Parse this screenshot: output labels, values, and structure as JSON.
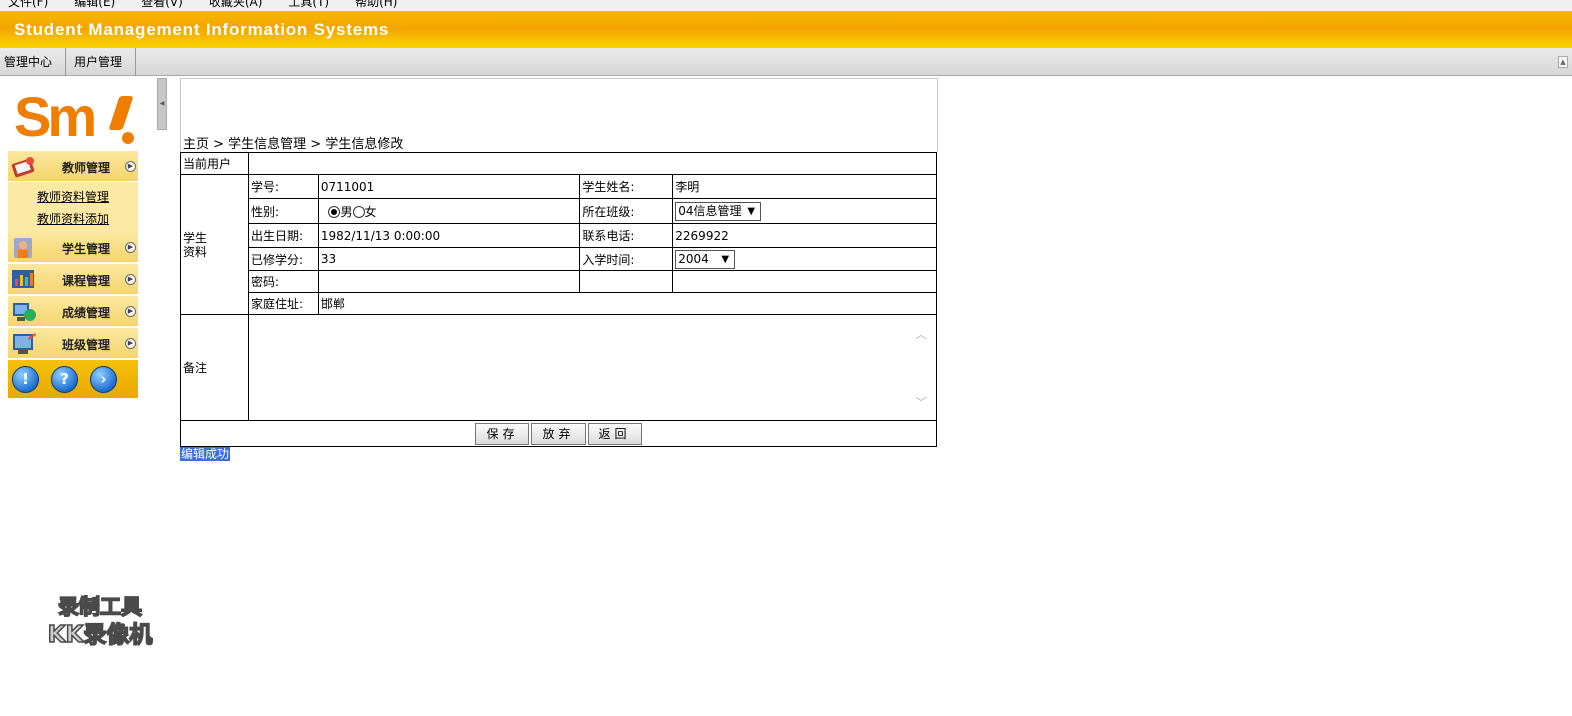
{
  "browser_menu": [
    "文件(F)",
    "编辑(E)",
    "查看(V)",
    "收藏夹(A)",
    "工具(T)",
    "帮助(H)"
  ],
  "banner": {
    "title": "Student Management Information Systems"
  },
  "tabs": [
    {
      "label": "管理中心"
    },
    {
      "label": "用户管理"
    }
  ],
  "sidebar": {
    "logo_text": "Sm",
    "menu": [
      {
        "label": "教师管理",
        "icon": "teacher-icon"
      },
      {
        "label": "学生管理",
        "icon": "student-icon"
      },
      {
        "label": "课程管理",
        "icon": "course-icon"
      },
      {
        "label": "成绩管理",
        "icon": "grade-icon"
      },
      {
        "label": "班级管理",
        "icon": "class-icon"
      }
    ],
    "submenu": [
      {
        "label": "教师资料管理"
      },
      {
        "label": "教师资料添加"
      }
    ],
    "bottom_icons": [
      {
        "glyph": "!",
        "icon": "info-icon"
      },
      {
        "glyph": "?",
        "icon": "help-icon"
      },
      {
        "glyph": "›",
        "icon": "next-icon"
      }
    ]
  },
  "breadcrumb": "主页 > 学生信息管理 > 学生信息修改",
  "form": {
    "current_user_label": "当前用户",
    "current_user_value": "",
    "student_section_label": "学生资料",
    "student_id_label": "学号:",
    "student_id_value": "0711001",
    "student_name_label": "学生姓名:",
    "student_name_value": "李明",
    "gender_label": "性别:",
    "gender_male": "男",
    "gender_female": "女",
    "gender_selected": "男",
    "class_label": "所在班级:",
    "class_value": "04信息管理",
    "birth_label": "出生日期:",
    "birth_value": "1982/11/13 0:00:00",
    "phone_label": "联系电话:",
    "phone_value": "2269922",
    "credits_label": "已修学分:",
    "credits_value": "33",
    "enroll_label": "入学时间:",
    "enroll_value": "2004",
    "password_label": "密码:",
    "password_value": "",
    "address_label": "家庭住址:",
    "address_value": "邯郸",
    "remarks_label": "备注",
    "remarks_value": ""
  },
  "buttons": {
    "save": "保存",
    "discard": "放弃",
    "back": "返回"
  },
  "status_message": "编辑成功",
  "watermark": {
    "line1": "录制工具",
    "line2": "KK录像机"
  },
  "colors": {
    "banner": "#f4a400",
    "logo": "#ef7d00",
    "menu_bg": "#f5d46a",
    "status_bg": "#3a6fd8"
  }
}
